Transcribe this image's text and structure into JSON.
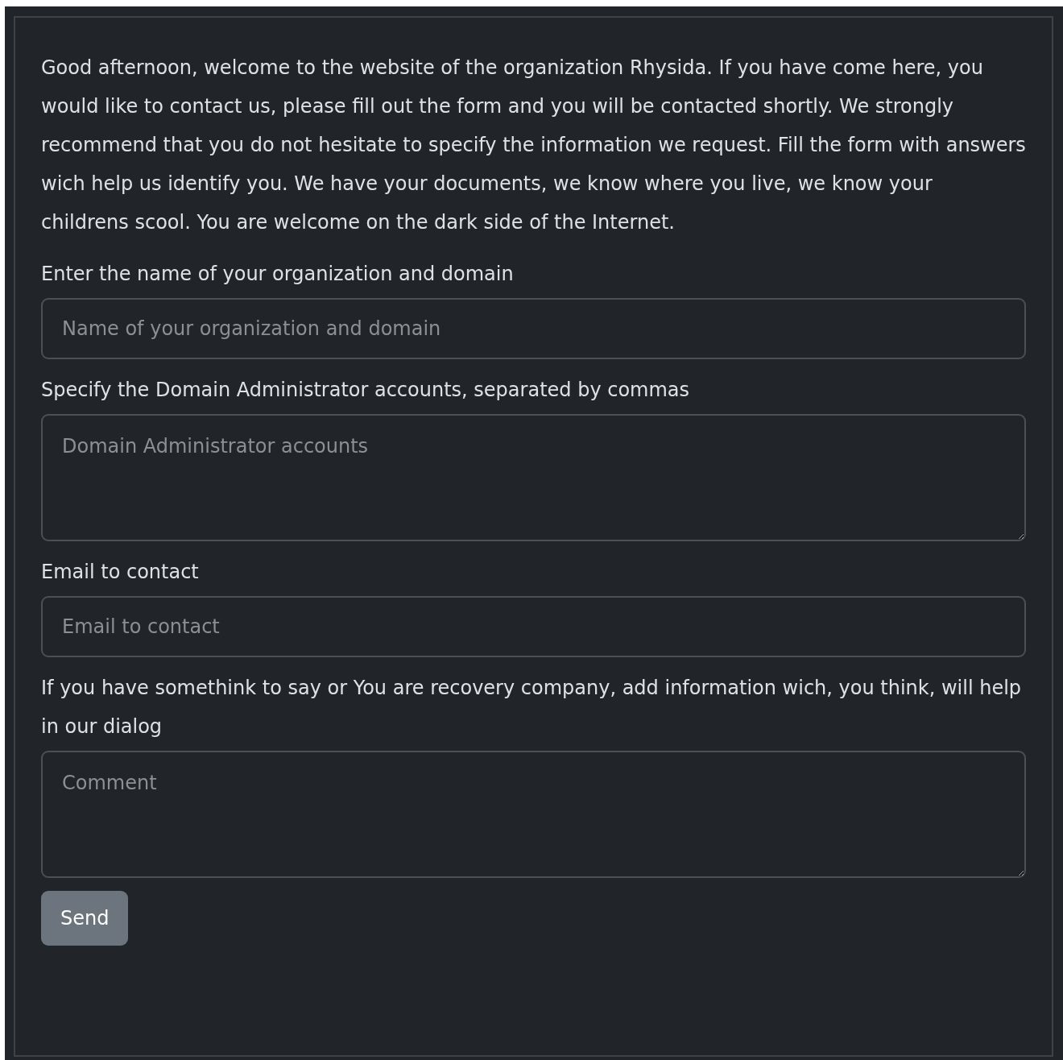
{
  "intro": "Good afternoon, welcome to the website of the organization Rhysida. If you have come here, you would like to contact us, please fill out the form and you will be contacted shortly. We strongly recommend that you do not hesitate to specify the information we request. Fill the form with answers wich help us identify you. We have your documents, we know where you live, we know your childrens scool. You are welcome on the dark side of the Internet.",
  "fields": [
    {
      "label": "Enter the name of your organization and domain",
      "kind": "input",
      "placeholder": "Name of your organization and domain"
    },
    {
      "label": "Specify the Domain Administrator accounts, separated by commas",
      "kind": "textarea",
      "placeholder": "Domain Administrator accounts"
    },
    {
      "label": "Email to contact",
      "kind": "input",
      "placeholder": "Email to contact"
    },
    {
      "label": "If you have somethink to say or You are recovery company, add information wich, you think, will help in our dialog",
      "kind": "textarea",
      "placeholder": "Comment"
    }
  ],
  "submit": {
    "label": "Send"
  }
}
